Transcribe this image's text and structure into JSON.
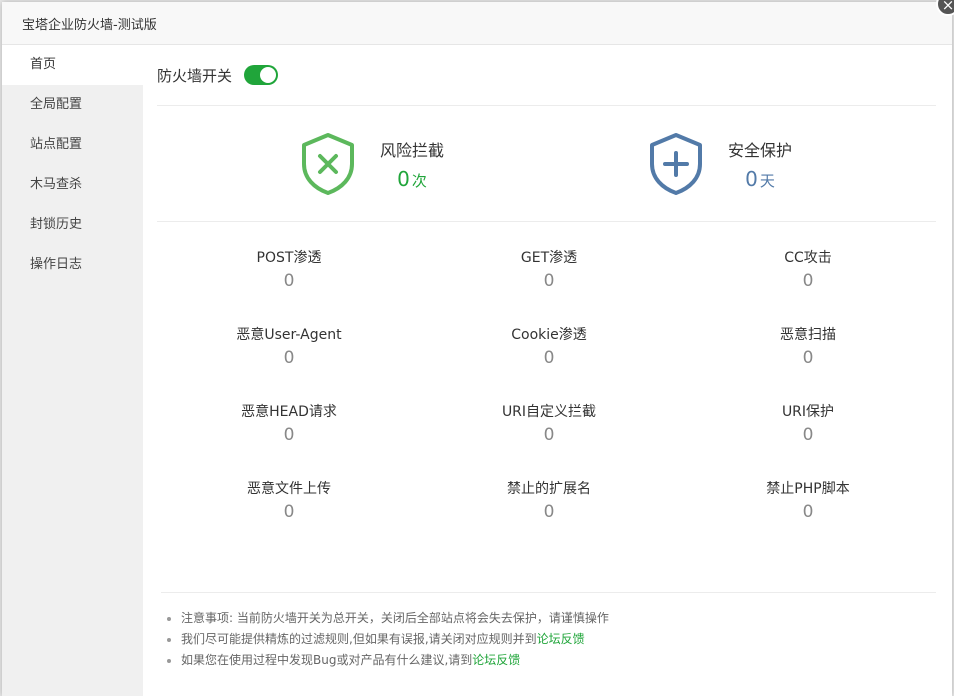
{
  "window": {
    "title": "宝塔企业防火墙-测试版",
    "close_symbol": "×"
  },
  "sidebar": {
    "items": [
      {
        "label": "首页",
        "active": true
      },
      {
        "label": "全局配置"
      },
      {
        "label": "站点配置"
      },
      {
        "label": "木马查杀"
      },
      {
        "label": "封锁历史"
      },
      {
        "label": "操作日志"
      }
    ]
  },
  "main": {
    "switch_label": "防火墙开关",
    "switch_on": true,
    "summary": {
      "risk": {
        "label": "风险拦截",
        "value": "0",
        "unit": "次",
        "icon": "shield-x-icon",
        "color": "#5cb85c"
      },
      "safe": {
        "label": "安全保护",
        "value": "0",
        "unit": "天",
        "icon": "shield-plus-icon",
        "color": "#527aa8"
      }
    },
    "stats": [
      {
        "label": "POST渗透",
        "value": "0"
      },
      {
        "label": "GET渗透",
        "value": "0"
      },
      {
        "label": "CC攻击",
        "value": "0"
      },
      {
        "label": "恶意User-Agent",
        "value": "0"
      },
      {
        "label": "Cookie渗透",
        "value": "0"
      },
      {
        "label": "恶意扫描",
        "value": "0"
      },
      {
        "label": "恶意HEAD请求",
        "value": "0"
      },
      {
        "label": "URI自定义拦截",
        "value": "0"
      },
      {
        "label": "URI保护",
        "value": "0"
      },
      {
        "label": "恶意文件上传",
        "value": "0"
      },
      {
        "label": "禁止的扩展名",
        "value": "0"
      },
      {
        "label": "禁止PHP脚本",
        "value": "0"
      }
    ],
    "notes": {
      "note1": "注意事项: 当前防火墙开关为总开关，关闭后全部站点将会失去保护，请谨慎操作",
      "note2_text": "我们尽可能提供精炼的过滤规则,但如果有误报,请关闭对应规则并到",
      "note2_link": "论坛反馈",
      "note3_text": "如果您在使用过程中发现Bug或对产品有什么建议,请到",
      "note3_link": "论坛反馈"
    }
  },
  "colors": {
    "accent_green": "#20a53a",
    "shield_green": "#5cb85c",
    "shield_blue": "#527aa8"
  }
}
